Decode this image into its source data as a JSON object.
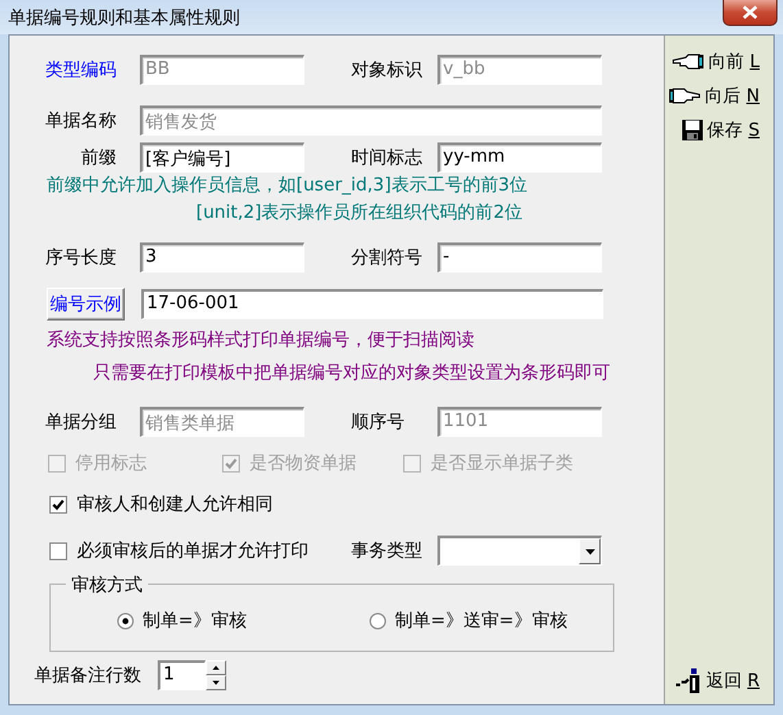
{
  "window": {
    "title": "单据编号规则和基本属性规则"
  },
  "type_code": {
    "label": "类型编码",
    "value": "BB",
    "disabled": true
  },
  "object_id": {
    "label": "对象标识",
    "value": "v_bb",
    "disabled": true
  },
  "doc_name": {
    "label": "单据名称",
    "value": "销售发货",
    "disabled": true
  },
  "prefix": {
    "label": "前缀",
    "value": "[客户编号]",
    "disabled": false
  },
  "time_mark": {
    "label": "时间标志",
    "value": "yy-mm",
    "disabled": false
  },
  "prefix_hints": [
    "前缀中允许加入操作员信息，如[user_id,3]表示工号的前3位",
    "[unit,2]表示操作员所在组织代码的前2位"
  ],
  "serial_length": {
    "label": "序号长度",
    "value": "3",
    "disabled": false
  },
  "separator": {
    "label": "分割符号",
    "value": "-",
    "disabled": false
  },
  "example": {
    "button": "编号示例",
    "value": "17-06-001"
  },
  "barcode_hints": [
    "系统支持按照条形码样式打印单据编号，便于扫描阅读",
    "只需要在打印模板中把单据编号对应的对象类型设置为条形码即可"
  ],
  "doc_group": {
    "label": "单据分组",
    "value": "销售类单据",
    "disabled": true
  },
  "order_no": {
    "label": "顺序号",
    "value": "1101",
    "disabled": true
  },
  "options": [
    {
      "label": "停用标志",
      "checked": false,
      "disabled": true
    },
    {
      "label": "是否物资单据",
      "checked": true,
      "disabled": true
    },
    {
      "label": "是否显示单据子类",
      "checked": false,
      "disabled": true
    }
  ],
  "same_person": {
    "label": "审核人和创建人允许相同",
    "checked": true,
    "disabled": false
  },
  "print_after_audit": {
    "label": "必须审核后的单据才允许打印",
    "checked": false,
    "disabled": false
  },
  "business_type": {
    "label": "事务类型"
  },
  "audit_mode": {
    "title": "审核方式",
    "options": [
      {
        "label": "制单=》审核",
        "selected": true
      },
      {
        "label": "制单=》送审=》审核",
        "selected": false
      }
    ]
  },
  "remark_lines": {
    "label": "单据备注行数",
    "value": "1"
  },
  "sidebar": {
    "buttons": [
      {
        "kind": "prev",
        "label": "向前",
        "key": "L"
      },
      {
        "kind": "next",
        "label": "向后",
        "key": "N"
      },
      {
        "kind": "save",
        "label": "保存",
        "key": "S"
      },
      {
        "kind": "back",
        "label": "返回",
        "key": "R"
      }
    ]
  }
}
